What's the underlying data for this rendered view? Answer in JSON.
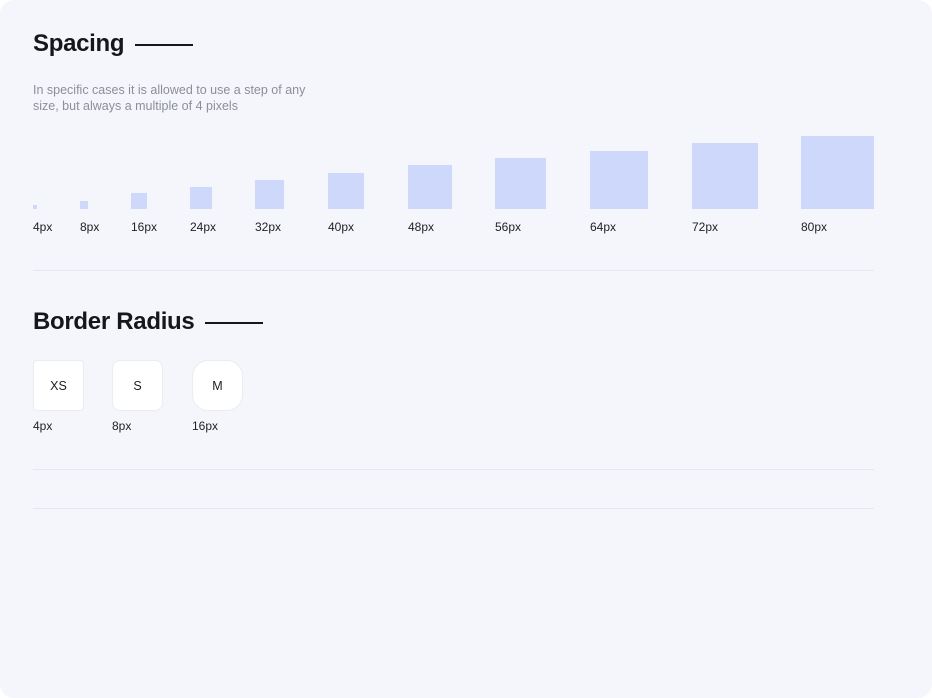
{
  "spacing": {
    "title": "Spacing",
    "description": "In specific cases it is allowed to use a step of any size, but always a multiple of 4 pixels",
    "steps": [
      {
        "label": "4px",
        "value": 4
      },
      {
        "label": "8px",
        "value": 8
      },
      {
        "label": "16px",
        "value": 16
      },
      {
        "label": "24px",
        "value": 24
      },
      {
        "label": "32px",
        "value": 32
      },
      {
        "label": "40px",
        "value": 40
      },
      {
        "label": "48px",
        "value": 48
      },
      {
        "label": "56px",
        "value": 56
      },
      {
        "label": "64px",
        "value": 64
      },
      {
        "label": "72px",
        "value": 72
      },
      {
        "label": "80px",
        "value": 80
      }
    ]
  },
  "border_radius": {
    "title": "Border Radius",
    "items": [
      {
        "name": "XS",
        "label": "4px",
        "value": 4
      },
      {
        "name": "S",
        "label": "8px",
        "value": 8
      },
      {
        "name": "M",
        "label": "16px",
        "value": 16
      }
    ]
  },
  "colors": {
    "background": "#f5f6fc",
    "swatch": "#cdd8fb",
    "text": "#15171c",
    "muted": "#8c8f99",
    "divider": "#e6e8f0"
  }
}
